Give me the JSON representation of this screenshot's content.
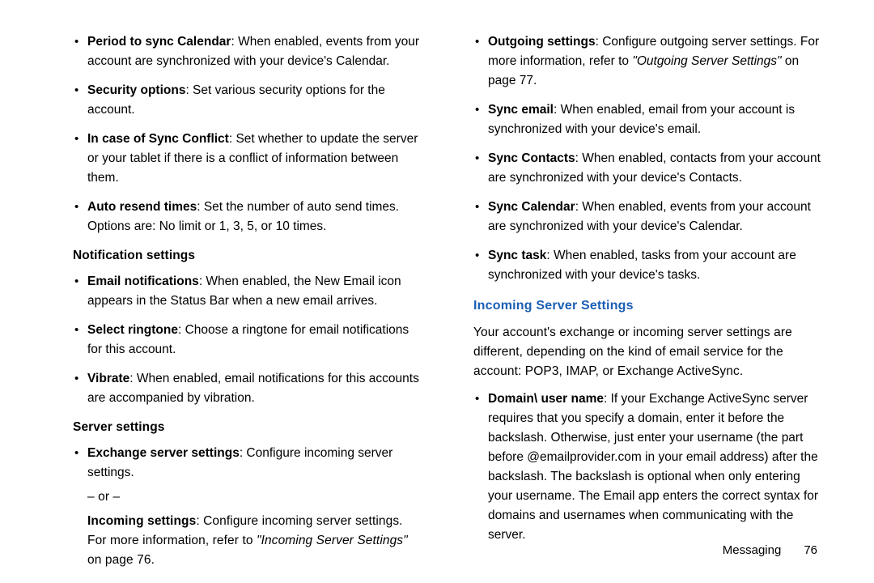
{
  "left": {
    "items_top": [
      {
        "term": "Period to sync Calendar",
        "text": ": When enabled, events from your account are synchronized with your device's Calendar."
      },
      {
        "term": "Security options",
        "text": ": Set various security options for the account."
      },
      {
        "term": "In case of Sync Conflict",
        "text": ": Set whether to update the server or your tablet if there is a conflict of information between them."
      },
      {
        "term": "Auto resend times",
        "text": ": Set the number of auto send times. Options are: No limit or 1, 3, 5, or 10 times."
      }
    ],
    "notif_head": "Notification settings",
    "notif_items": [
      {
        "term": "Email notifications",
        "text": ": When enabled, the New Email icon appears in the Status Bar when a new email arrives."
      },
      {
        "term": "Select ringtone",
        "text": ": Choose a ringtone for email notifications for this account."
      },
      {
        "term": "Vibrate",
        "text": ": When enabled, email notifications for this accounts are accompanied by vibration."
      }
    ],
    "server_head": "Server settings",
    "server_item": {
      "term": "Exchange server settings",
      "text": ": Configure incoming server settings."
    },
    "or": "– or –",
    "incoming_label": "Incoming settings",
    "incoming_text_a": ": Configure incoming server settings. For more information, refer to ",
    "incoming_ref": "\"Incoming Server Settings\"",
    "incoming_text_b": " on page 76."
  },
  "right": {
    "items_top": [
      {
        "term": "Outgoing settings",
        "text_a": ": Configure outgoing server settings. For more information, refer to ",
        "ref": "\"Outgoing Server Settings\"",
        "text_b": " on page 77."
      },
      {
        "term": "Sync email",
        "text_a": ": When enabled, email from your account is synchronized with your device's email.",
        "ref": "",
        "text_b": ""
      },
      {
        "term": "Sync Contacts",
        "text_a": ": When enabled, contacts from your account are synchronized with your device's Contacts.",
        "ref": "",
        "text_b": ""
      },
      {
        "term": "Sync Calendar",
        "text_a": ": When enabled, events from your account are synchronized with your device's Calendar.",
        "ref": "",
        "text_b": ""
      },
      {
        "term": "Sync task",
        "text_a": ": When enabled, tasks from your account are synchronized with your device's tasks.",
        "ref": "",
        "text_b": ""
      }
    ],
    "section_title": "Incoming Server Settings",
    "intro": "Your account's exchange or incoming server settings are different, depending on the kind of email service for the account: POP3, IMAP, or Exchange ActiveSync.",
    "domain_item": {
      "term": "Domain\\ user name",
      "text": ": If your Exchange ActiveSync server requires that you specify a domain, enter it before the backslash. Otherwise, just enter your username (the part before @emailprovider.com in your email address) after the backslash. The backslash is optional when only entering your username. The Email app enters the correct syntax for domains and usernames when communicating with the server."
    }
  },
  "footer": {
    "label": "Messaging",
    "page": "76"
  }
}
